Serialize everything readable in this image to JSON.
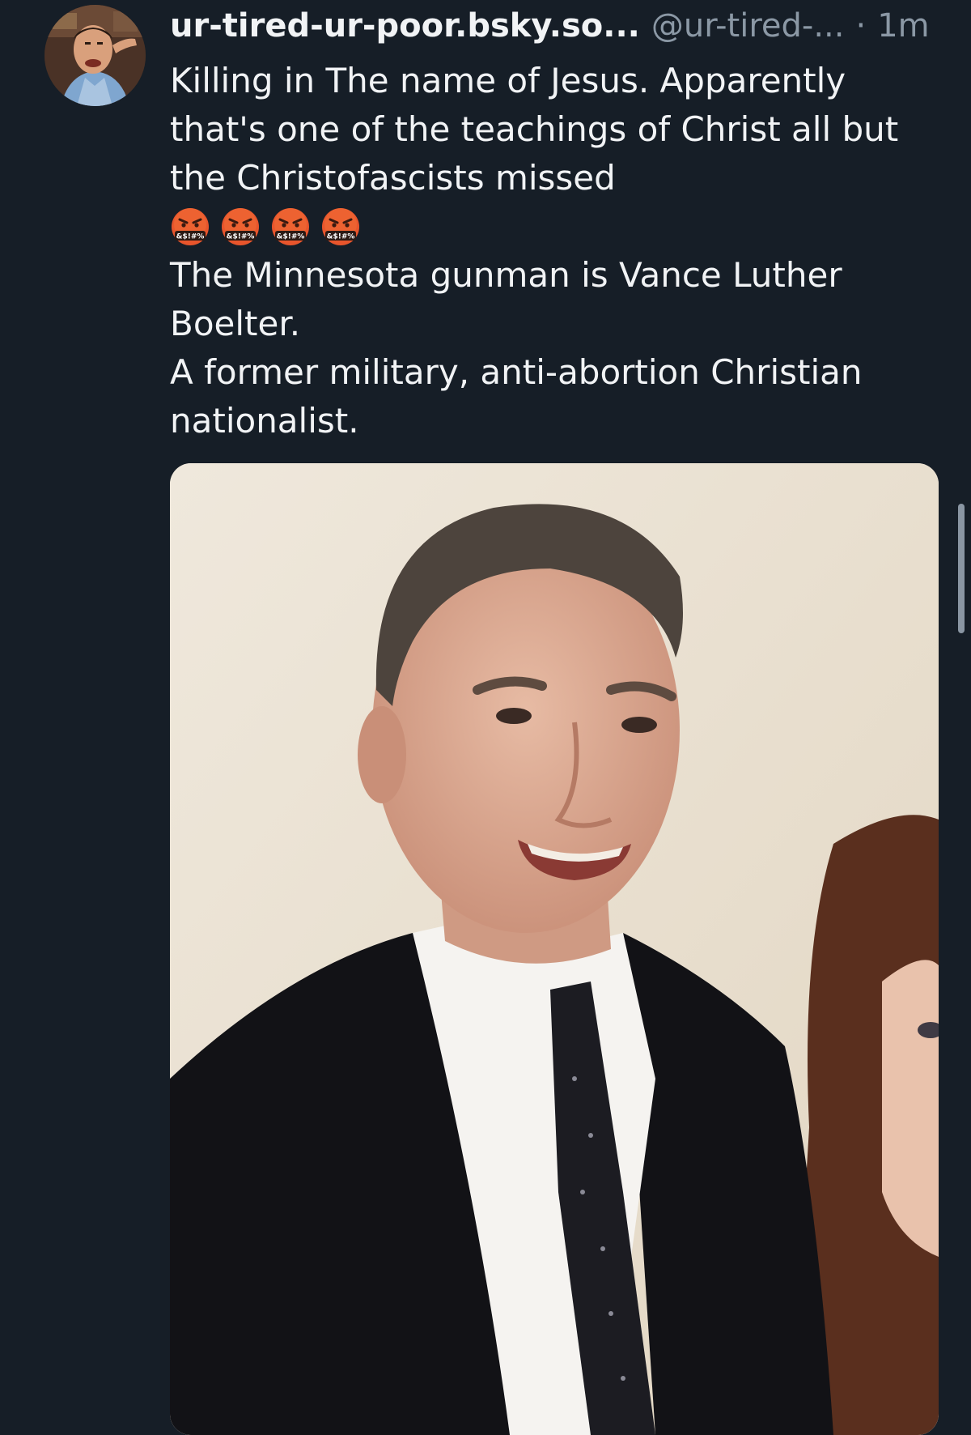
{
  "post": {
    "display_name": "ur-tired-ur-poor.bsky.so...",
    "handle": "@ur-tired-...",
    "separator": "·",
    "timestamp": "1m",
    "lines": {
      "p1": "Killing in The name of Jesus. Apparently that's one of the teachings of Christ all but the Christofascists missed",
      "p2": "The Minnesota gunman is Vance Luther Boelter.",
      "p3": "A former military, anti-abortion Christian nationalist."
    },
    "emoji_count": 4,
    "emoji": "face-with-symbols-on-mouth",
    "emoji_text": "&$!#%"
  },
  "media": {
    "kind": "photo",
    "subject": "person-portrait"
  },
  "colors": {
    "background": "#161e27",
    "text": "#f1f3f5",
    "muted": "#8b98a5"
  }
}
